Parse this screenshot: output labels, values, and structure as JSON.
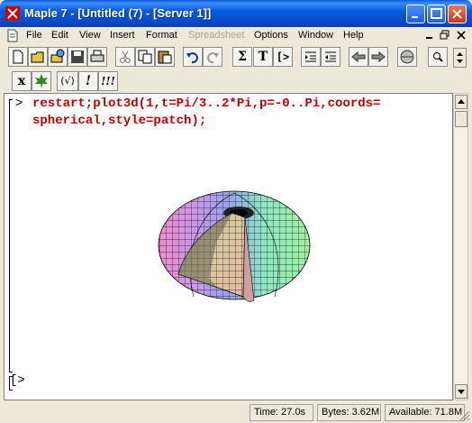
{
  "window": {
    "title": "Maple 7  - [Untitled (7) - [Server 1]]"
  },
  "menu": {
    "items": [
      "File",
      "Edit",
      "View",
      "Insert",
      "Format",
      "Spreadsheet",
      "Options",
      "Window",
      "Help"
    ],
    "disabled": [
      "Spreadsheet"
    ]
  },
  "toolbar": {
    "sum_glyph": "Σ",
    "text_glyph": "T",
    "exec_glyph": "[>",
    "math_x": "x",
    "check_glyph": "(√)",
    "bang_glyph": "!",
    "bang3_glyph": "!!!"
  },
  "worksheet": {
    "prompt": ">",
    "command_line1": "restart;plot3d(1,t=Pi/3..2*Pi,p=-0..Pi,coords=",
    "command_line2": "spherical,style=patch);",
    "empty_prompt": "[>"
  },
  "status": {
    "time": "Time:  27.0s",
    "bytes": "Bytes: 3.62M",
    "available": "Available: 71.8M"
  },
  "icons": [
    "maple-leaf-icon",
    "new-icon",
    "open-icon",
    "save-icon",
    "print-icon",
    "cut-icon",
    "copy-icon",
    "paste-icon",
    "undo-icon",
    "redo-icon",
    "sum-icon",
    "text-icon",
    "execute-icon",
    "indent-icon",
    "outdent-icon",
    "back-icon",
    "forward-icon",
    "stop-icon",
    "zoom-icon"
  ]
}
